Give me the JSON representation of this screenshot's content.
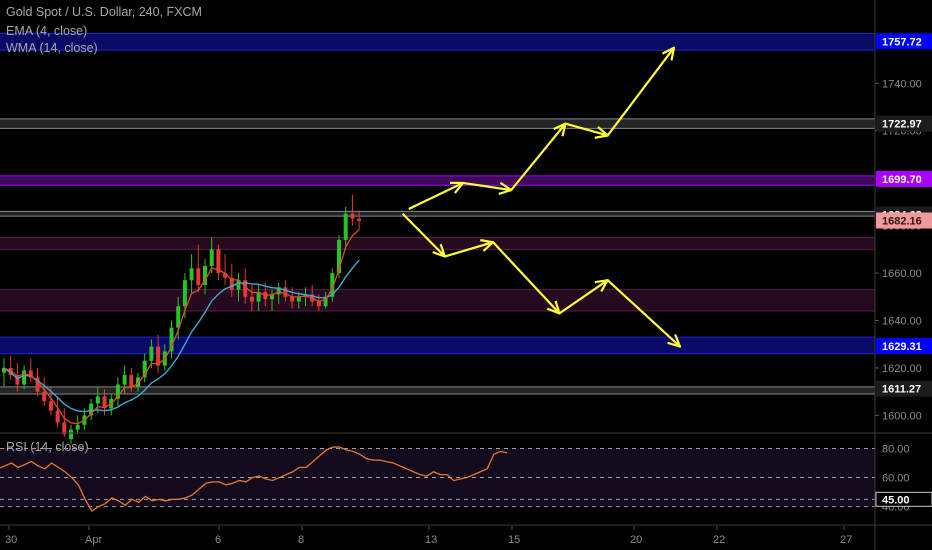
{
  "header": {
    "symbol_title": "Gold Spot / U.S. Dollar, 240, FXCM",
    "indicator_1": "EMA (4, close)",
    "indicator_2": "WMA (14, close)"
  },
  "rsi": {
    "title": "RSI (14, close)",
    "levels": [
      80,
      60,
      45,
      40
    ],
    "level_labels": [
      "80.00",
      "60.00",
      "45.00",
      "40.00"
    ],
    "highlight_label": "45.00",
    "ylim": [
      28,
      90
    ],
    "values": [
      66,
      68,
      70,
      67,
      69,
      71,
      68,
      66,
      70,
      67,
      64,
      60,
      55,
      45,
      37,
      40,
      42,
      46,
      44,
      41,
      45,
      43,
      47,
      44,
      45,
      44,
      45,
      45,
      46,
      48,
      52,
      56,
      57,
      57,
      55,
      56,
      58,
      57,
      60,
      61,
      59,
      58,
      60,
      62,
      64,
      67,
      67,
      71,
      75,
      79,
      81,
      81,
      79,
      78,
      76,
      73,
      72,
      72,
      71,
      70,
      68,
      66,
      64,
      62,
      61,
      64,
      62,
      62,
      58,
      59,
      60,
      62,
      64,
      66,
      76,
      78,
      77
    ]
  },
  "price_axis": {
    "ticks": [
      1740,
      1720,
      1700,
      1680,
      1660,
      1640,
      1620,
      1600
    ],
    "tick_labels": [
      "1740.00",
      "1720.00",
      "1700.00",
      "1680.00",
      "1660.00",
      "1640.00",
      "1620.00",
      "1600.00"
    ],
    "ylim": [
      1593,
      1765
    ]
  },
  "price_tags": [
    {
      "label": "1757.72",
      "value": 1757.72,
      "bg": "#0000ff",
      "fg": "#ffffff"
    },
    {
      "label": "1722.97",
      "value": 1722.97,
      "bg": "#1c1c1c",
      "fg": "#ffffff"
    },
    {
      "label": "1699.70",
      "value": 1699.7,
      "bg": "#aa00ff",
      "fg": "#ffffff"
    },
    {
      "label": "1684.68",
      "value": 1684.68,
      "bg": "#1c1c1c",
      "fg": "#ffffff"
    },
    {
      "label": "1682.16",
      "value": 1682.16,
      "bg": "#ef9a9a",
      "fg": "#3a1010"
    },
    {
      "label": "1629.31",
      "value": 1629.31,
      "bg": "#0000ff",
      "fg": "#ffffff"
    },
    {
      "label": "1611.27",
      "value": 1611.27,
      "bg": "#1c1c1c",
      "fg": "#ffffff"
    }
  ],
  "time_axis": {
    "labels": [
      "30",
      "Apr",
      "6",
      "8",
      "13",
      "15",
      "20",
      "22",
      "27"
    ]
  },
  "chart_data": {
    "type": "candlestick",
    "title": "Gold Spot / U.S. Dollar, 240, FXCM",
    "ylim": [
      1593,
      1765
    ],
    "candles": [
      [
        1618,
        1624,
        1612,
        1620
      ],
      [
        1620,
        1625,
        1615,
        1617
      ],
      [
        1617,
        1622,
        1610,
        1613
      ],
      [
        1613,
        1621,
        1611,
        1619
      ],
      [
        1619,
        1624,
        1614,
        1616
      ],
      [
        1616,
        1620,
        1608,
        1610
      ],
      [
        1610,
        1616,
        1604,
        1606
      ],
      [
        1606,
        1612,
        1600,
        1602
      ],
      [
        1602,
        1608,
        1595,
        1597
      ],
      [
        1597,
        1603,
        1591,
        1592
      ],
      [
        1590,
        1596,
        1588,
        1594
      ],
      [
        1594,
        1600,
        1592,
        1596
      ],
      [
        1596,
        1603,
        1594,
        1600
      ],
      [
        1600,
        1607,
        1598,
        1605
      ],
      [
        1605,
        1612,
        1601,
        1608
      ],
      [
        1608,
        1611,
        1600,
        1603
      ],
      [
        1603,
        1609,
        1600,
        1607
      ],
      [
        1607,
        1616,
        1604,
        1613
      ],
      [
        1613,
        1621,
        1609,
        1617
      ],
      [
        1617,
        1620,
        1610,
        1612
      ],
      [
        1612,
        1618,
        1610,
        1616
      ],
      [
        1616,
        1626,
        1614,
        1623
      ],
      [
        1623,
        1632,
        1620,
        1629
      ],
      [
        1629,
        1634,
        1618,
        1621
      ],
      [
        1621,
        1630,
        1619,
        1627
      ],
      [
        1627,
        1640,
        1624,
        1637
      ],
      [
        1637,
        1650,
        1632,
        1646
      ],
      [
        1646,
        1660,
        1641,
        1657
      ],
      [
        1657,
        1668,
        1651,
        1662
      ],
      [
        1662,
        1672,
        1652,
        1655
      ],
      [
        1655,
        1666,
        1651,
        1663
      ],
      [
        1663,
        1675,
        1660,
        1670
      ],
      [
        1670,
        1672,
        1657,
        1660
      ],
      [
        1660,
        1668,
        1655,
        1658
      ],
      [
        1658,
        1664,
        1650,
        1653
      ],
      [
        1653,
        1660,
        1648,
        1657
      ],
      [
        1657,
        1662,
        1647,
        1650
      ],
      [
        1650,
        1655,
        1644,
        1648
      ],
      [
        1648,
        1655,
        1644,
        1652
      ],
      [
        1652,
        1656,
        1646,
        1649
      ],
      [
        1649,
        1653,
        1644,
        1651
      ],
      [
        1651,
        1656,
        1647,
        1654
      ],
      [
        1654,
        1657,
        1648,
        1650
      ],
      [
        1650,
        1654,
        1645,
        1648
      ],
      [
        1648,
        1652,
        1645,
        1650
      ],
      [
        1650,
        1654,
        1646,
        1651
      ],
      [
        1651,
        1655,
        1646,
        1648
      ],
      [
        1648,
        1651,
        1644,
        1646
      ],
      [
        1646,
        1652,
        1645,
        1650
      ],
      [
        1650,
        1662,
        1648,
        1660
      ],
      [
        1660,
        1676,
        1658,
        1674
      ],
      [
        1674,
        1688,
        1670,
        1685
      ],
      [
        1685,
        1693,
        1680,
        1683
      ],
      [
        1683,
        1686,
        1678,
        1682
      ]
    ],
    "ema": {
      "name": "EMA (4, close)"
    },
    "wma": {
      "name": "WMA (14, close)"
    },
    "zones": [
      {
        "from": 1754,
        "to": 1761,
        "kind": "blue"
      },
      {
        "from": 1721,
        "to": 1725,
        "kind": "grey"
      },
      {
        "from": 1697,
        "to": 1701,
        "kind": "purple"
      },
      {
        "from": 1684,
        "to": 1686,
        "kind": "grey"
      },
      {
        "from": 1670,
        "to": 1675,
        "kind": "magenta"
      },
      {
        "from": 1644,
        "to": 1653,
        "kind": "magenta"
      },
      {
        "from": 1626,
        "to": 1633,
        "kind": "blue"
      },
      {
        "from": 1609,
        "to": 1612,
        "kind": "grey"
      }
    ],
    "projection_up": [
      [
        11.2,
        1687
      ],
      [
        13.0,
        1698
      ],
      [
        14.6,
        1695
      ],
      [
        16.4,
        1723
      ],
      [
        17.8,
        1718
      ],
      [
        20.0,
        1755
      ]
    ],
    "projection_down": [
      [
        11.0,
        1685
      ],
      [
        12.4,
        1667
      ],
      [
        14.0,
        1673
      ],
      [
        16.2,
        1643
      ],
      [
        17.8,
        1657
      ],
      [
        20.2,
        1629
      ]
    ]
  }
}
